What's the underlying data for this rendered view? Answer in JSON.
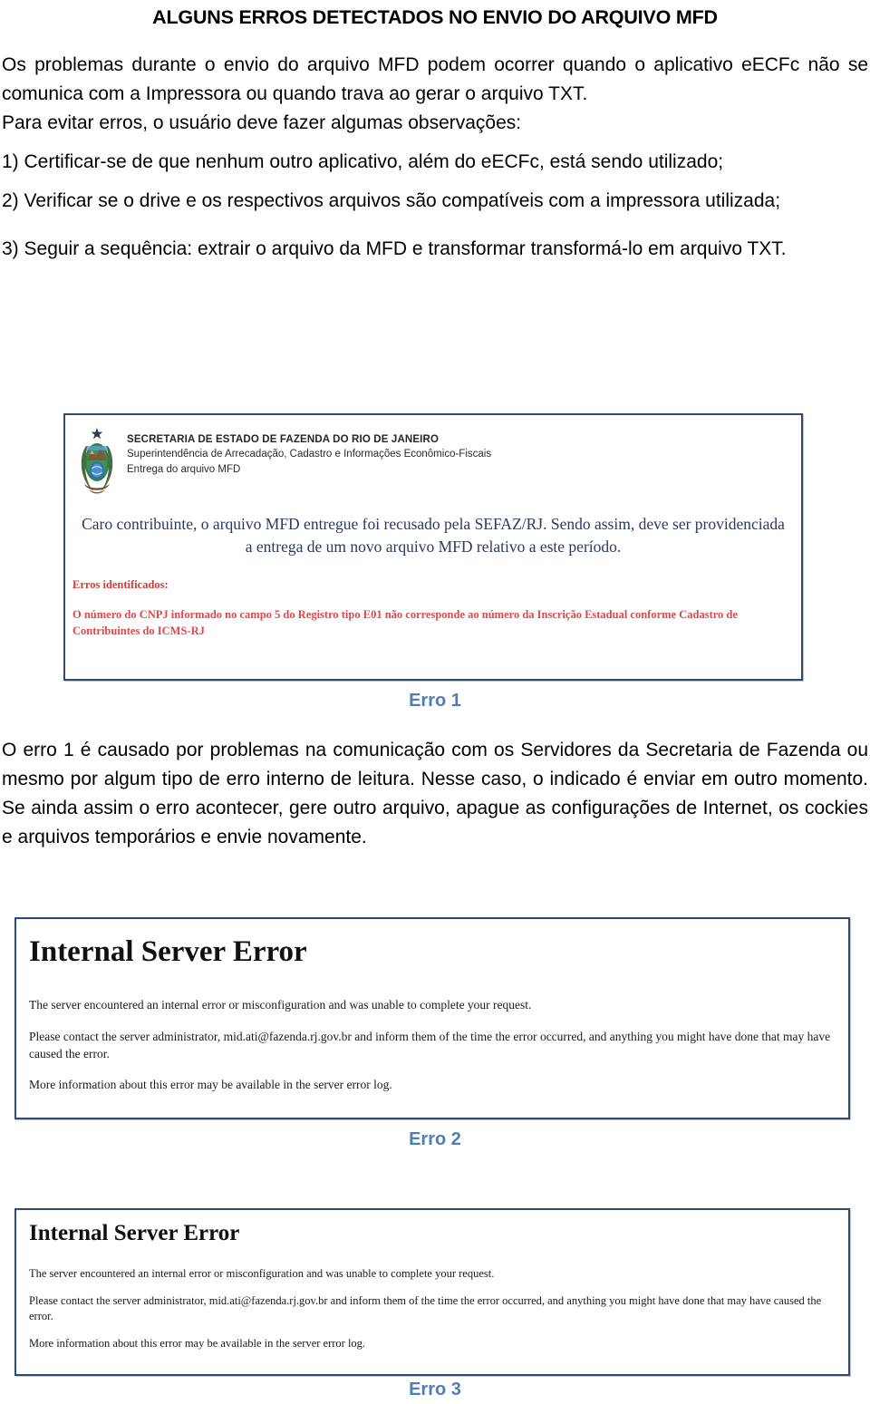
{
  "document": {
    "title": "ALGUNS ERROS DETECTADOS NO ENVIO DO ARQUIVO MFD",
    "intro_paragraph": "Os problemas durante o envio do arquivo MFD podem ocorrer quando o aplicativo eECFc não se comunica com a Impressora ou quando trava ao gerar o arquivo TXT.",
    "intro_paragraph_2": "Para evitar erros, o usuário deve fazer algumas observações:",
    "items": [
      "1) Certificar-se de que nenhum outro aplicativo, além do eECFc, está sendo utilizado;",
      "2) Verificar se o drive e os respectivos arquivos são compatíveis com a impressora utilizada;",
      "3) Seguir a sequência: extrair o arquivo da MFD e transformar transformá-lo em arquivo TXT."
    ],
    "erro1_explanation": "O erro 1 é causado por problemas na comunicação com os Servidores da Secretaria de Fazenda ou mesmo por algum tipo de erro interno de leitura. Nesse caso, o indicado é enviar em outro momento. Se ainda assim o erro acontecer, gere outro arquivo, apague as configurações de Internet, os cockies e arquivos temporários e envie novamente."
  },
  "captions": {
    "erro1": "Erro 1",
    "erro2": "Erro 2",
    "erro3": "Erro 3"
  },
  "figure_sefaz": {
    "emblem_name": "rio-de-janeiro-coat-of-arms-icon",
    "header_line1": "SECRETARIA DE ESTADO DE FAZENDA DO RIO DE JANEIRO",
    "header_line2": "Superintendência de Arrecadação, Cadastro e Informações Econômico-Fiscais",
    "header_line3": "Entrega do arquivo MFD",
    "message": "Caro contribuinte, o arquivo MFD entregue foi recusado pela SEFAZ/RJ. Sendo assim, deve ser providenciada a entrega de um novo arquivo MFD relativo a este período.",
    "errors_label": "Erros identificados:",
    "error_detail": "O número do CNPJ informado no campo 5 do Registro tipo E01 não corresponde ao número da Inscrição Estadual conforme Cadastro de Contribuintes do ICMS-RJ",
    "message_color": "#2b3a63",
    "error_color": "#e0484b"
  },
  "figure_internal_error": {
    "heading": "Internal Server Error",
    "line1": "The server encountered an internal error or misconfiguration and was unable to complete your request.",
    "line2": "Please contact the server administrator, mid.ati@fazenda.rj.gov.br and inform them of the time the error occurred, and anything you might have done that may have caused the error.",
    "line3": "More information about this error may be available in the server error log.",
    "admin_email": "mid.ati@fazenda.rj.gov.br"
  },
  "theme": {
    "caption_blue": "#4f7eb3",
    "box_border": "#2e4a73",
    "page_background": "#ffffff",
    "text_color": "#000000"
  }
}
